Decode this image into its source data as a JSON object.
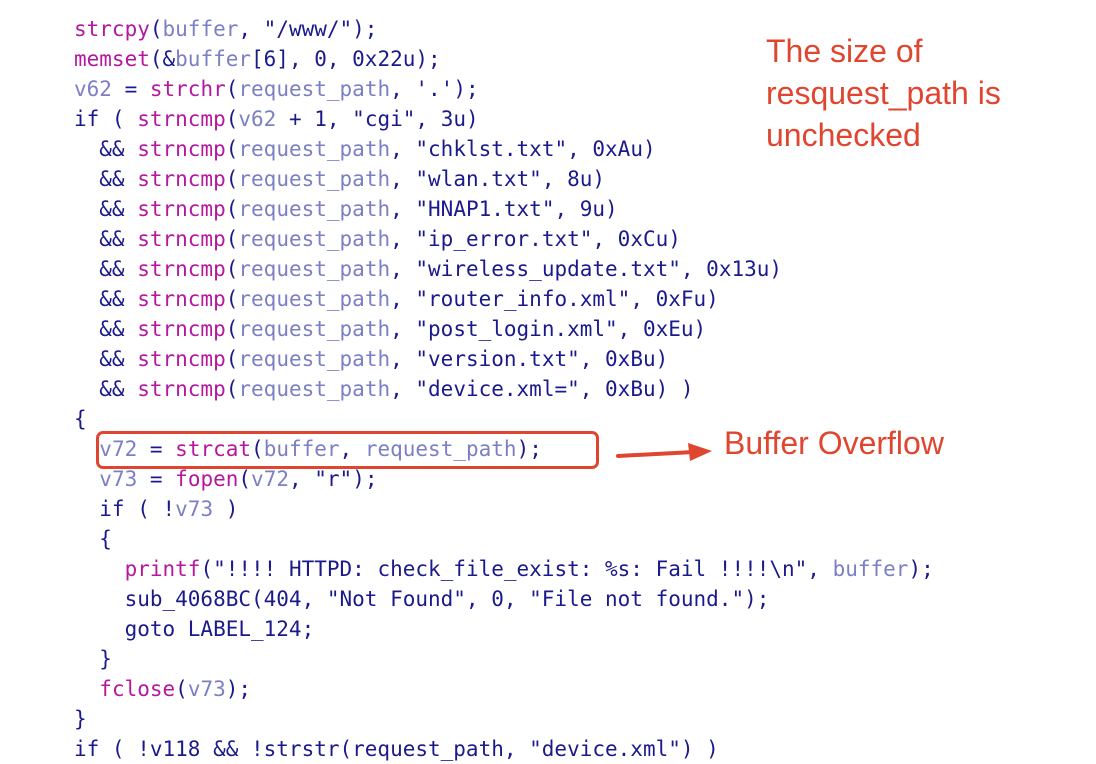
{
  "colors": {
    "plain": "#1a1a8c",
    "func": "#b5179e",
    "var": "#7b7fc4",
    "annotation": "#e0462f"
  },
  "code_lines": [
    [
      [
        "func",
        "strcpy"
      ],
      [
        "plain",
        "("
      ],
      [
        "var",
        "buffer"
      ],
      [
        "plain",
        ", \"/www/\");"
      ]
    ],
    [
      [
        "func",
        "memset"
      ],
      [
        "plain",
        "(&"
      ],
      [
        "var",
        "buffer"
      ],
      [
        "plain",
        "[6], 0, 0x22u);"
      ]
    ],
    [
      [
        "var",
        "v62"
      ],
      [
        "plain",
        " = "
      ],
      [
        "func",
        "strchr"
      ],
      [
        "plain",
        "("
      ],
      [
        "var",
        "request_path"
      ],
      [
        "plain",
        ", '.');"
      ]
    ],
    [
      [
        "plain",
        "if ( "
      ],
      [
        "func",
        "strncmp"
      ],
      [
        "plain",
        "("
      ],
      [
        "var",
        "v62"
      ],
      [
        "plain",
        " + 1, \"cgi\", 3u)"
      ]
    ],
    [
      [
        "plain",
        "  && "
      ],
      [
        "func",
        "strncmp"
      ],
      [
        "plain",
        "("
      ],
      [
        "var",
        "request_path"
      ],
      [
        "plain",
        ", \"chklst.txt\", 0xAu)"
      ]
    ],
    [
      [
        "plain",
        "  && "
      ],
      [
        "func",
        "strncmp"
      ],
      [
        "plain",
        "("
      ],
      [
        "var",
        "request_path"
      ],
      [
        "plain",
        ", \"wlan.txt\", 8u)"
      ]
    ],
    [
      [
        "plain",
        "  && "
      ],
      [
        "func",
        "strncmp"
      ],
      [
        "plain",
        "("
      ],
      [
        "var",
        "request_path"
      ],
      [
        "plain",
        ", \"HNAP1.txt\", 9u)"
      ]
    ],
    [
      [
        "plain",
        "  && "
      ],
      [
        "func",
        "strncmp"
      ],
      [
        "plain",
        "("
      ],
      [
        "var",
        "request_path"
      ],
      [
        "plain",
        ", \"ip_error.txt\", 0xCu)"
      ]
    ],
    [
      [
        "plain",
        "  && "
      ],
      [
        "func",
        "strncmp"
      ],
      [
        "plain",
        "("
      ],
      [
        "var",
        "request_path"
      ],
      [
        "plain",
        ", \"wireless_update.txt\", 0x13u)"
      ]
    ],
    [
      [
        "plain",
        "  && "
      ],
      [
        "func",
        "strncmp"
      ],
      [
        "plain",
        "("
      ],
      [
        "var",
        "request_path"
      ],
      [
        "plain",
        ", \"router_info.xml\", 0xFu)"
      ]
    ],
    [
      [
        "plain",
        "  && "
      ],
      [
        "func",
        "strncmp"
      ],
      [
        "plain",
        "("
      ],
      [
        "var",
        "request_path"
      ],
      [
        "plain",
        ", \"post_login.xml\", 0xEu)"
      ]
    ],
    [
      [
        "plain",
        "  && "
      ],
      [
        "func",
        "strncmp"
      ],
      [
        "plain",
        "("
      ],
      [
        "var",
        "request_path"
      ],
      [
        "plain",
        ", \"version.txt\", 0xBu)"
      ]
    ],
    [
      [
        "plain",
        "  && "
      ],
      [
        "func",
        "strncmp"
      ],
      [
        "plain",
        "("
      ],
      [
        "var",
        "request_path"
      ],
      [
        "plain",
        ", \"device.xml=\", 0xBu) )"
      ]
    ],
    [
      [
        "plain",
        "{"
      ]
    ],
    [
      [
        "plain",
        "  "
      ],
      [
        "var",
        "v72"
      ],
      [
        "plain",
        " = "
      ],
      [
        "func",
        "strcat"
      ],
      [
        "plain",
        "("
      ],
      [
        "var",
        "buffer"
      ],
      [
        "plain",
        ", "
      ],
      [
        "var",
        "request_path"
      ],
      [
        "plain",
        ");"
      ]
    ],
    [
      [
        "plain",
        "  "
      ],
      [
        "var",
        "v73"
      ],
      [
        "plain",
        " = "
      ],
      [
        "func",
        "fopen"
      ],
      [
        "plain",
        "("
      ],
      [
        "var",
        "v72"
      ],
      [
        "plain",
        ", \"r\");"
      ]
    ],
    [
      [
        "plain",
        "  if ( !"
      ],
      [
        "var",
        "v73"
      ],
      [
        "plain",
        " )"
      ]
    ],
    [
      [
        "plain",
        "  {"
      ]
    ],
    [
      [
        "plain",
        "    "
      ],
      [
        "func",
        "printf"
      ],
      [
        "plain",
        "(\"!!!! HTTPD: check_file_exist: %s: Fail !!!!\\n\", "
      ],
      [
        "var",
        "buffer"
      ],
      [
        "plain",
        ");"
      ]
    ],
    [
      [
        "plain",
        "    sub_4068BC(404, \"Not Found\", 0, \"File not found.\");"
      ]
    ],
    [
      [
        "plain",
        "    goto LABEL_124;"
      ]
    ],
    [
      [
        "plain",
        "  }"
      ]
    ],
    [
      [
        "plain",
        "  "
      ],
      [
        "func",
        "fclose"
      ],
      [
        "plain",
        "("
      ],
      [
        "var",
        "v73"
      ],
      [
        "plain",
        ");"
      ]
    ],
    [
      [
        "plain",
        "}"
      ]
    ],
    [
      [
        "plain",
        "if ( !v118 && !strstr(request_path, \"device.xml\") )"
      ]
    ]
  ],
  "annotations": {
    "size_note": "The size of resquest_path is unchecked",
    "overflow_note": "Buffer Overflow"
  }
}
